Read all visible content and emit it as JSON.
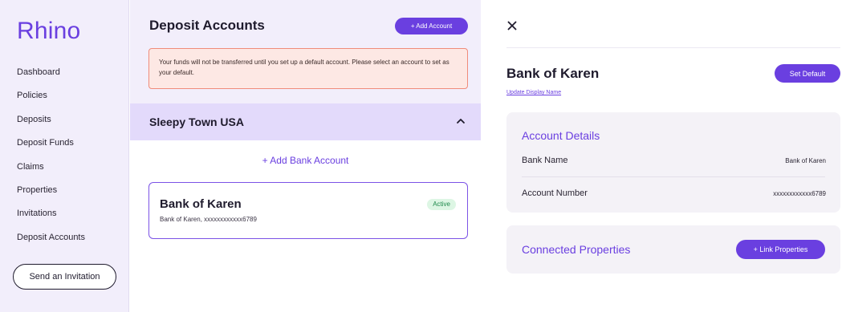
{
  "brand": {
    "name": "Rhino",
    "accent": "#6a3fe0"
  },
  "sidebar": {
    "items": [
      {
        "label": "Dashboard"
      },
      {
        "label": "Policies"
      },
      {
        "label": "Deposits"
      },
      {
        "label": "Deposit Funds"
      },
      {
        "label": "Claims"
      },
      {
        "label": "Properties"
      },
      {
        "label": "Invitations"
      },
      {
        "label": "Deposit Accounts"
      }
    ],
    "invite_label": "Send an Invitation"
  },
  "main": {
    "title": "Deposit Accounts",
    "add_account_label": "+ Add Account",
    "alert_text": "Your funds will not be transferred until you set up a default account. Please select an account to set as your default.",
    "group": {
      "title": "Sleepy Town USA",
      "chevron_icon": "chevron-up-icon",
      "add_bank_label": "+ Add Bank Account",
      "card": {
        "name": "Bank of Karen",
        "subtitle": "Bank of Karen, xxxxxxxxxxxx6789",
        "status": "Active"
      }
    }
  },
  "detail": {
    "close_icon": "close-icon",
    "title": "Bank of Karen",
    "set_default_label": "Set Default",
    "update_name_label": "Update Display Name",
    "account_details": {
      "heading": "Account Details",
      "rows": [
        {
          "label": "Bank Name",
          "value": "Bank of Karen"
        },
        {
          "label": "Account Number",
          "value": "xxxxxxxxxxxx6789"
        }
      ]
    },
    "connected": {
      "heading": "Connected Properties",
      "link_label": "+ Link Properties"
    }
  }
}
